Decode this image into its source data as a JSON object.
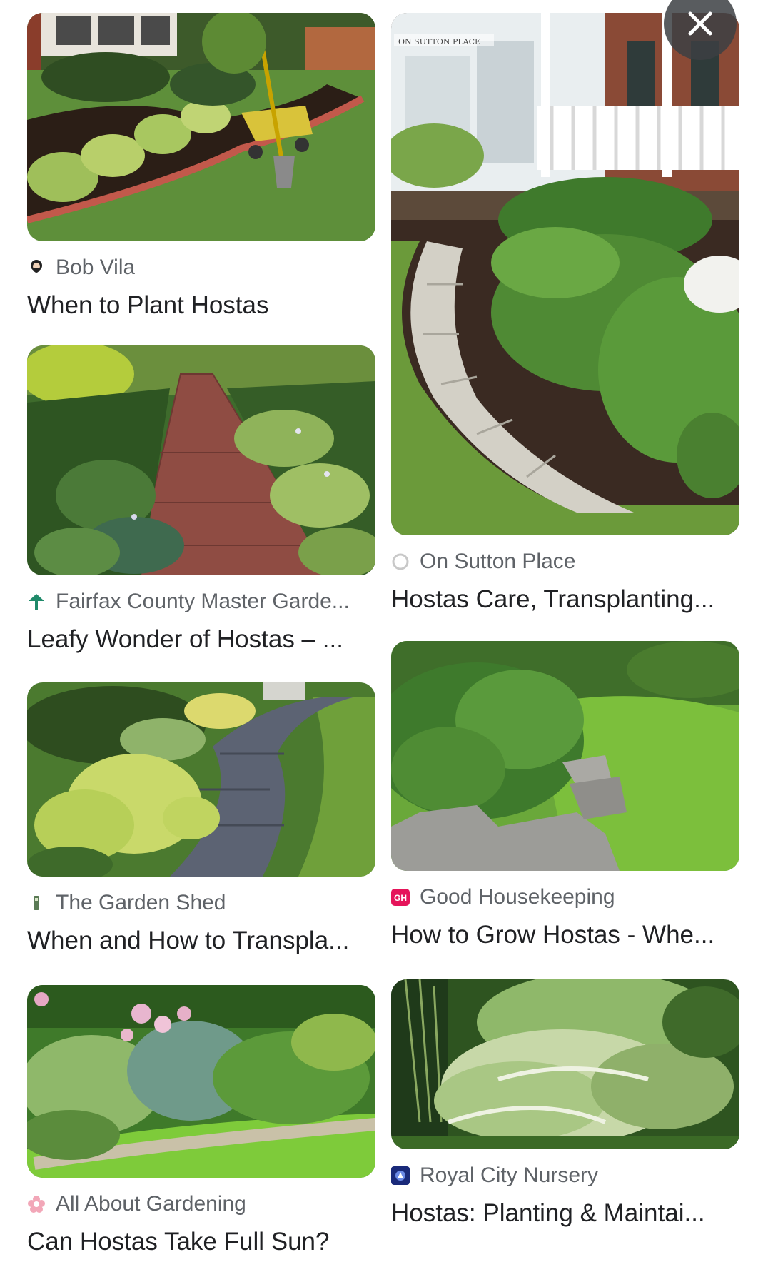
{
  "results": {
    "left": [
      {
        "source": "Bob Vila",
        "title": "When to Plant Hostas",
        "favicon": "bearded-man-icon"
      },
      {
        "source": "Fairfax County Master Garde...",
        "title": "Leafy Wonder of Hostas – ...",
        "favicon": "tree-icon"
      },
      {
        "source": "The Garden Shed",
        "title": "When and How to Transpla...",
        "favicon": "shed-icon"
      },
      {
        "source": "All About Gardening",
        "title": "Can Hostas Take Full Sun?",
        "favicon": "flower-icon"
      }
    ],
    "right": [
      {
        "source": "On Sutton Place",
        "title": "Hostas Care, Transplanting...",
        "favicon": "circle-logo-icon",
        "watermark": "ON SUTTON PLACE"
      },
      {
        "source": "Good Housekeeping",
        "title": "How to Grow Hostas - Whe...",
        "favicon": "gh-logo-icon",
        "badge": "GH"
      },
      {
        "source": "Royal City Nursery",
        "title": "Hostas: Planting & Maintai...",
        "favicon": "nursery-logo-icon"
      }
    ]
  },
  "close_button": {
    "icon": "close-icon"
  },
  "colors": {
    "source_text": "#5f6368",
    "title_text": "#202124",
    "gh_badge": "#e5145a",
    "close_bg": "#3c4043"
  }
}
